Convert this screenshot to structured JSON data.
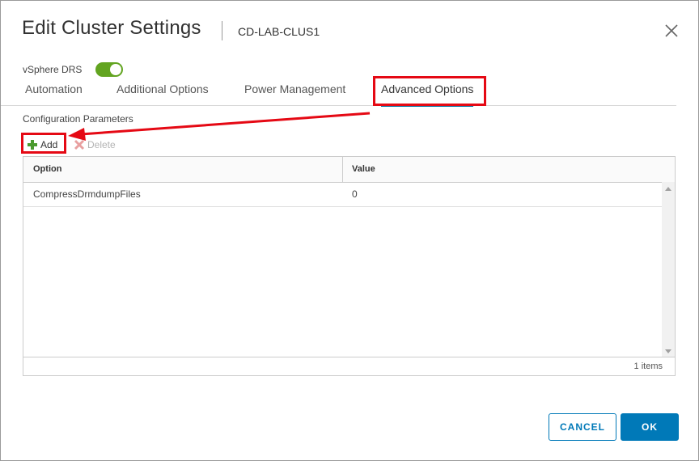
{
  "dialog": {
    "title": "Edit Cluster Settings",
    "subtitle": "CD-LAB-CLUS1"
  },
  "drs": {
    "label": "vSphere DRS",
    "enabled": true
  },
  "tabs": [
    {
      "label": "Automation",
      "active": false
    },
    {
      "label": "Additional Options",
      "active": false
    },
    {
      "label": "Power Management",
      "active": false
    },
    {
      "label": "Advanced Options",
      "active": true
    }
  ],
  "config": {
    "section_label": "Configuration Parameters",
    "add_label": "Add",
    "delete_label": "Delete",
    "columns": [
      "Option",
      "Value"
    ],
    "rows": [
      {
        "option": "CompressDrmdumpFiles",
        "value": "0"
      }
    ],
    "items_count": "1 items"
  },
  "buttons": {
    "cancel": "CANCEL",
    "ok": "OK"
  },
  "colors": {
    "toggle_on": "#62a420",
    "primary": "#0079b8",
    "annotation": "#e50914"
  },
  "icons": [
    "close-icon",
    "add-icon",
    "delete-icon",
    "scroll-up-icon",
    "scroll-down-icon"
  ]
}
